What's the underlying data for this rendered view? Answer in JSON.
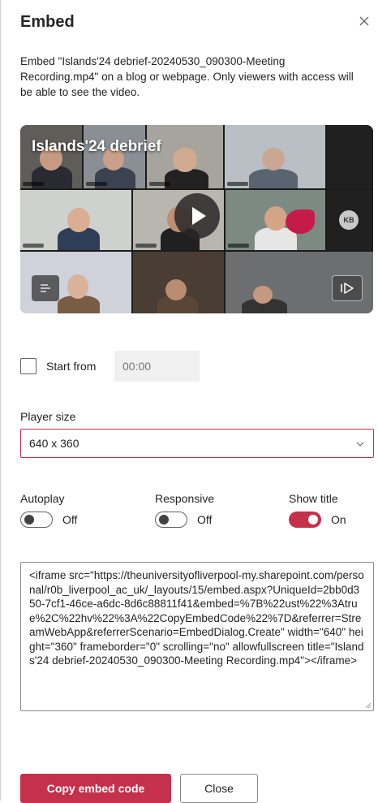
{
  "dialog": {
    "title": "Embed",
    "description": "Embed \"Islands'24 debrief-20240530_090300-Meeting Recording.mp4\" on a blog or webpage. Only viewers with access will be able to see the video."
  },
  "video": {
    "overlay_title": "Islands'24 debrief",
    "avatar_initials": "KB",
    "icons": [
      "play-icon",
      "chapters-icon",
      "share-icon"
    ]
  },
  "start_from": {
    "label": "Start from",
    "checked": false,
    "placeholder": "00:00"
  },
  "player_size": {
    "label": "Player size",
    "selected": "640 x 360"
  },
  "toggles": {
    "autoplay": {
      "label": "Autoplay",
      "state": "Off"
    },
    "responsive": {
      "label": "Responsive",
      "state": "Off"
    },
    "show_title": {
      "label": "Show title",
      "state": "On"
    }
  },
  "embed_code": "<iframe src=\"https://theuniversityofliverpool-my.sharepoint.com/personal/r0b_liverpool_ac_uk/_layouts/15/embed.aspx?UniqueId=2bb0d350-7cf1-46ce-a6dc-8d6c88811f41&embed=%7B%22ust%22%3Atrue%2C%22hv%22%3A%22CopyEmbedCode%22%7D&referrer=StreamWebApp&referrerScenario=EmbedDialog.Create\" width=\"640\" height=\"360\" frameborder=\"0\" scrolling=\"no\" allowfullscreen title=\"Islands'24 debrief-20240530_090300-Meeting Recording.mp4\"></iframe>",
  "buttons": {
    "copy": "Copy embed code",
    "close": "Close"
  },
  "colors": {
    "accent": "#c4314b",
    "text": "#242424",
    "input_bg": "#f0f0f0"
  }
}
